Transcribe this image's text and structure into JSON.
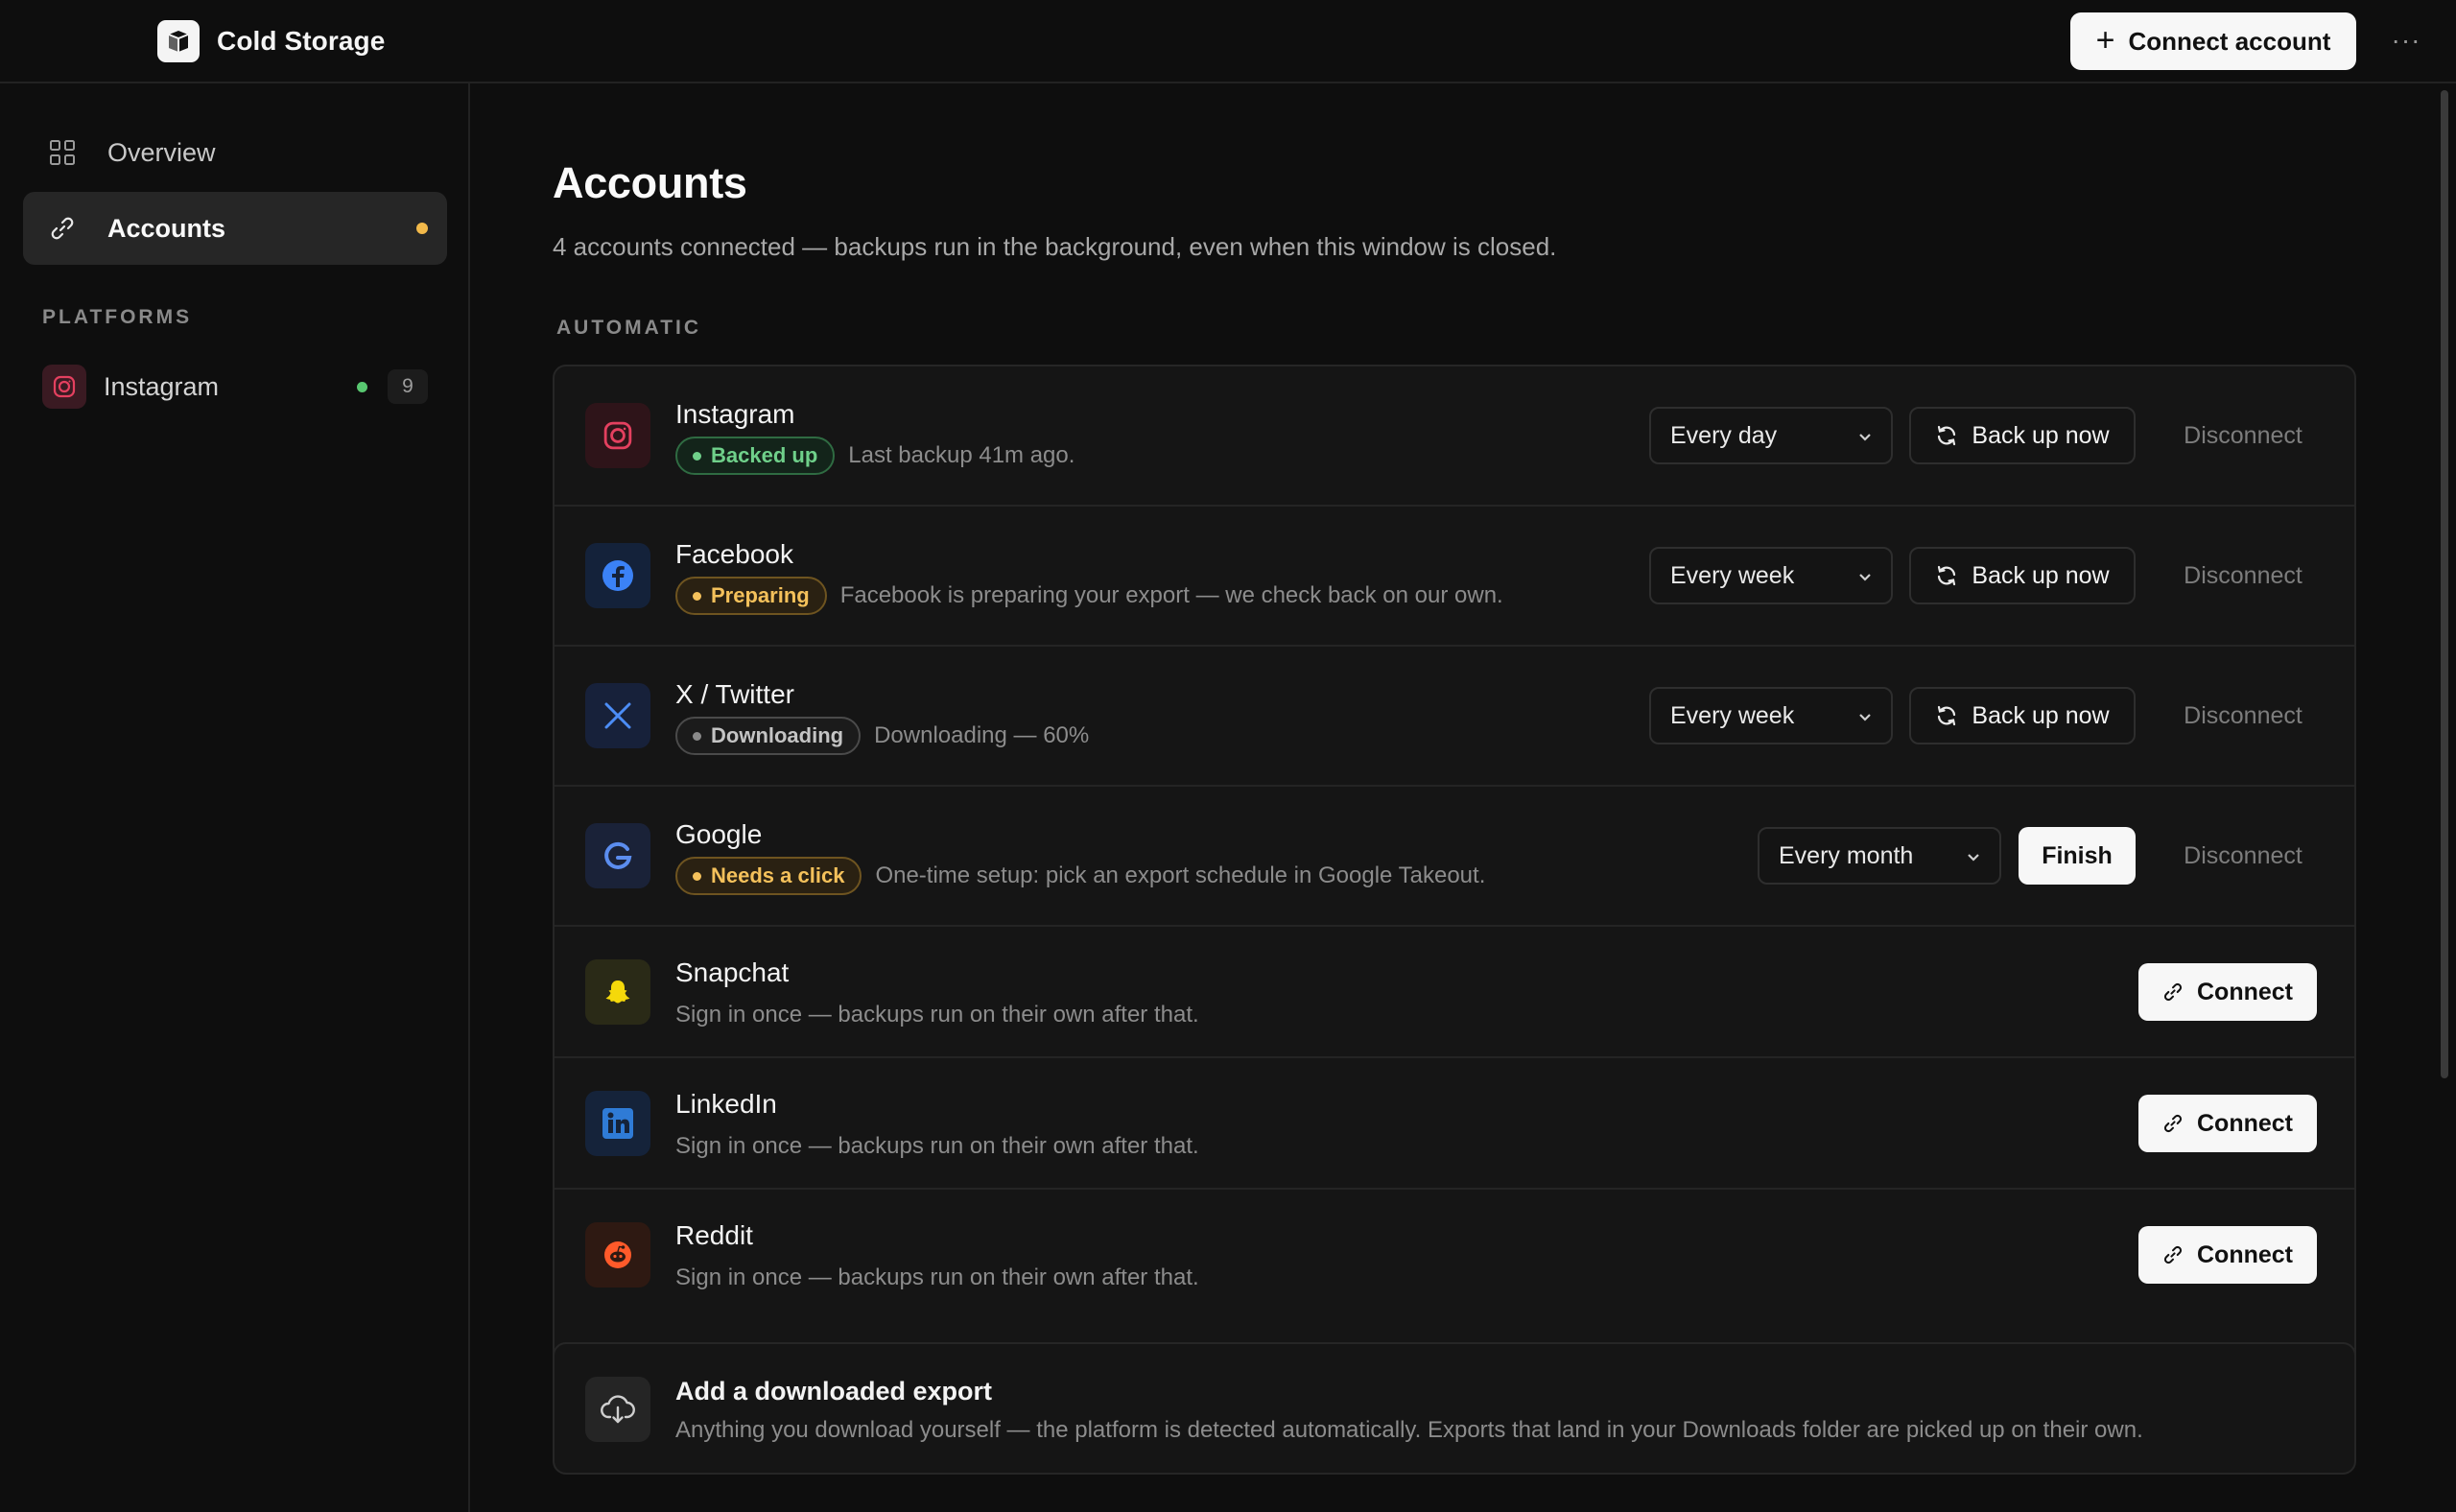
{
  "app": {
    "name": "Cold Storage",
    "connect_account_label": "Connect account",
    "more_label": "···"
  },
  "sidebar": {
    "nav": [
      {
        "label": "Overview",
        "icon": "grid-icon",
        "active": false
      },
      {
        "label": "Accounts",
        "icon": "link-icon",
        "active": true
      }
    ],
    "section_label": "PLATFORMS",
    "platforms": [
      {
        "label": "Instagram",
        "icon": "instagram-icon",
        "count": "9",
        "status_color": "#58c770"
      }
    ]
  },
  "main": {
    "title": "Accounts",
    "subtitle": "4 accounts connected — backups run in the background, even when this window is closed.",
    "section_label": "AUTOMATIC",
    "connected": [
      {
        "name": "Instagram",
        "icon": "instagram-icon",
        "badge": "Backed up",
        "badge_tone": "green",
        "status": "Last backup 41m ago.",
        "schedule": "Every day",
        "action": "Back up now",
        "disconnect": "Disconnect"
      },
      {
        "name": "Facebook",
        "icon": "facebook-icon",
        "badge": "Preparing",
        "badge_tone": "amber",
        "status": "Facebook is preparing your export — we check back on our own.",
        "schedule": "Every week",
        "action": "Back up now",
        "disconnect": "Disconnect"
      },
      {
        "name": "X / Twitter",
        "icon": "x-twitter-icon",
        "badge": "Downloading",
        "badge_tone": "gray",
        "status": "Downloading — 60%",
        "schedule": "Every week",
        "action": "Back up now",
        "disconnect": "Disconnect"
      },
      {
        "name": "Google",
        "icon": "google-icon",
        "badge": "Needs a click",
        "badge_tone": "amber",
        "status": "One-time setup: pick an export schedule in Google Takeout.",
        "schedule": "Every month",
        "action": "Finish",
        "disconnect": "Disconnect"
      }
    ],
    "available": [
      {
        "name": "Snapchat",
        "icon": "snapchat-icon",
        "desc": "Sign in once — backups run on their own after that.",
        "action": "Connect"
      },
      {
        "name": "LinkedIn",
        "icon": "linkedin-icon",
        "desc": "Sign in once — backups run on their own after that.",
        "action": "Connect"
      },
      {
        "name": "Reddit",
        "icon": "reddit-icon",
        "desc": "Sign in once — backups run on their own after that.",
        "action": "Connect"
      }
    ],
    "export": {
      "title": "Add a downloaded export",
      "desc": "Anything you download yourself — the platform is detected automatically. Exports that land in your Downloads folder are picked up on their own.",
      "icon": "cloud-download-icon"
    }
  },
  "colors": {
    "background": "#0e0e0e",
    "card": "#151515",
    "accent_amber": "#f2b94a",
    "success_green": "#6fd08a",
    "instagram": "#e4405f",
    "facebook": "#3b82f6",
    "x_twitter": "#4c8df6",
    "google": "#5b8def",
    "snapchat": "#f5d90a",
    "linkedin": "#2f7bd6",
    "reddit": "#ff5a2a"
  }
}
